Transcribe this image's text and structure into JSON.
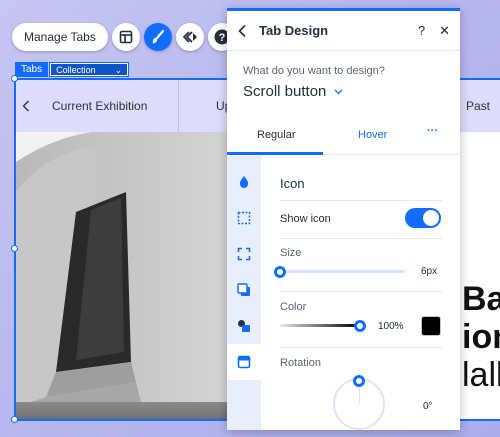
{
  "toolbar": {
    "manage_label": "Manage Tabs",
    "icons": [
      "layout-icon",
      "paintbrush-icon",
      "animation-icon",
      "help-icon"
    ]
  },
  "tag": {
    "name": "Tabs",
    "dropdown_value": "Collection"
  },
  "tabbar": {
    "items": [
      "Current Exhibition",
      "Up",
      "Past"
    ]
  },
  "canvas_text": {
    "line1": "Ba",
    "line2": "ior",
    "line3": "lall"
  },
  "panel": {
    "title": "Tab Design",
    "question": "What do you want to design?",
    "design_target": "Scroll button",
    "tabs": {
      "regular": "Regular",
      "hover": "Hover",
      "more": "···"
    },
    "section_title": "Icon",
    "show_icon": {
      "label": "Show icon",
      "on": true
    },
    "size": {
      "label": "Size",
      "value": "6px",
      "fraction": 0.0
    },
    "color": {
      "label": "Color",
      "value": "100%",
      "swatch": "#000000",
      "opacity_fraction": 1.0
    },
    "rotation": {
      "label": "Rotation",
      "value": "0°",
      "degrees": 0
    },
    "side_icons": [
      "fill-icon",
      "border-icon",
      "corners-icon",
      "shadow-icon",
      "icon-style-icon",
      "layout-icon"
    ]
  },
  "colors": {
    "accent": "#116dff",
    "tabbar_bg": "#dcdcfb",
    "side_bg": "#e7effd"
  }
}
